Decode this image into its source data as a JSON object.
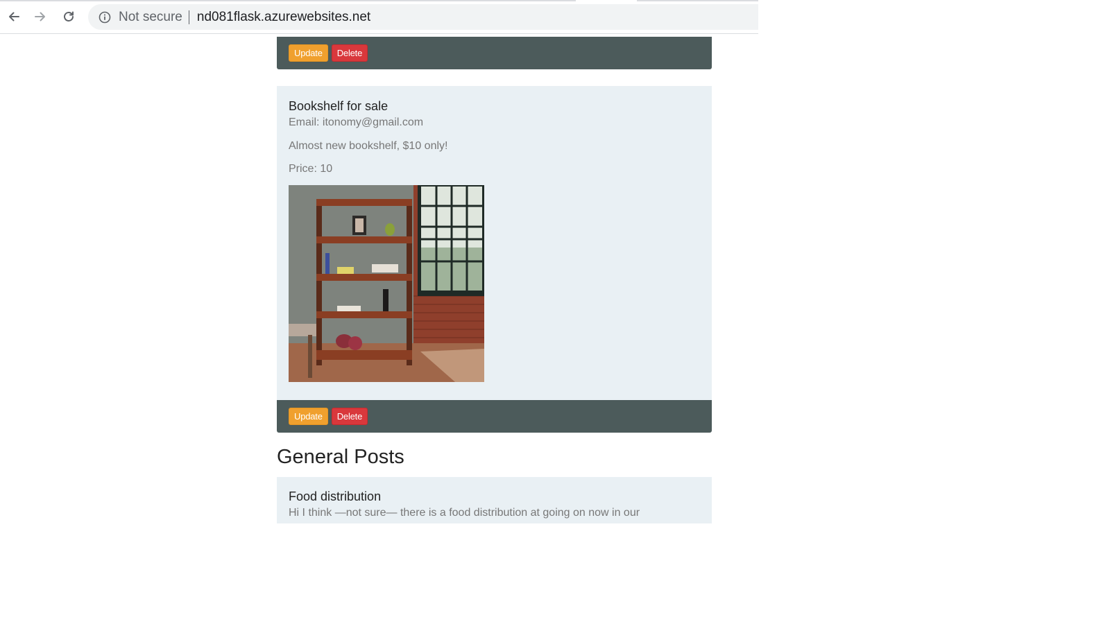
{
  "browser": {
    "security_label": "Not secure",
    "url": "nd081flask.azurewebsites.net"
  },
  "posts": [
    {
      "update_label": "Update",
      "delete_label": "Delete"
    },
    {
      "title": "Bookshelf for sale",
      "email": "Email: itonomy@gmail.com",
      "description": "Almost new bookshelf, $10 only!",
      "price": "Price: 10",
      "update_label": "Update",
      "delete_label": "Delete"
    }
  ],
  "general_section": {
    "heading": "General Posts",
    "posts": [
      {
        "title": "Food distribution",
        "text": "Hi I think —not sure— there is a food distribution at going on now in our"
      }
    ]
  },
  "colors": {
    "footer_bar": "#4c5b5b",
    "card_bg": "#e9f0f4",
    "warning": "#f0a02e",
    "danger": "#d9383c"
  }
}
